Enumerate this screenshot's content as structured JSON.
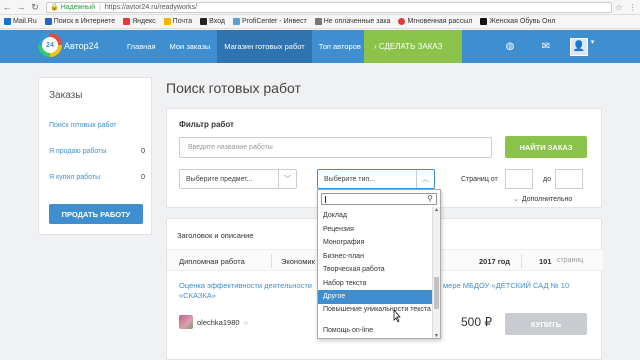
{
  "browser": {
    "secure_label": "Надежный",
    "url": "https://avtor24.ru/readyworks/",
    "bookmarks": [
      "Mail.Ru",
      "Поиск в Интернете",
      "Яндекс",
      "Почта",
      "Вход",
      "ProfiCenter - Инвест",
      "Не оплаченные зака",
      "Мгновенная рассыл",
      "Женская Обувь Онл"
    ]
  },
  "header": {
    "brand": "Автор24",
    "nav": [
      "Главная",
      "Мои заказы",
      "Магазин готовых работ",
      "Топ авторов"
    ],
    "order_button": "›  СДЕЛАТЬ ЗАКАЗ"
  },
  "sidebar": {
    "title": "Заказы",
    "items": [
      {
        "label": "Поиск готовых работ",
        "count": ""
      },
      {
        "label": "Я продаю работы",
        "count": "0"
      },
      {
        "label": "Я купил работы",
        "count": "0"
      }
    ],
    "sell_button": "ПРОДАТЬ РАБОТУ"
  },
  "main": {
    "title": "Поиск готовых работ",
    "filter": {
      "title": "Фильтр работ",
      "name_placeholder": "Введите название работы",
      "find_button": "НАЙТИ ЗАКАЗ",
      "subject_select": "Выберите предмет...",
      "type_select": "Выберите тип...",
      "pages_from": "Страниц от",
      "pages_to": "до",
      "advanced": "Дополнительно"
    },
    "results": {
      "header": "Заголовок и описание",
      "type": "Дипломная работа",
      "subject": "Экономик",
      "year": "2017 год",
      "pages": "101",
      "pages_suffix": "страниц",
      "title_left": "Оценка эффективности деятельности",
      "title_right": "мере МБДОУ «ДЕТСКИЙ САД № 10",
      "title_line2": "«СКАЗКА»",
      "author": "olechka1980",
      "author_status": "○",
      "price": "500 ₽",
      "buy_button": "КУПИТЬ"
    }
  },
  "dropdown": {
    "items": [
      "Доклад",
      "Рецензия",
      "Монография",
      "Бизнес-план",
      "Творческая работа",
      "Набор текста",
      "Другое",
      "Повышение уникальности текста",
      "Помощь on-line"
    ],
    "selected": "Другое"
  }
}
